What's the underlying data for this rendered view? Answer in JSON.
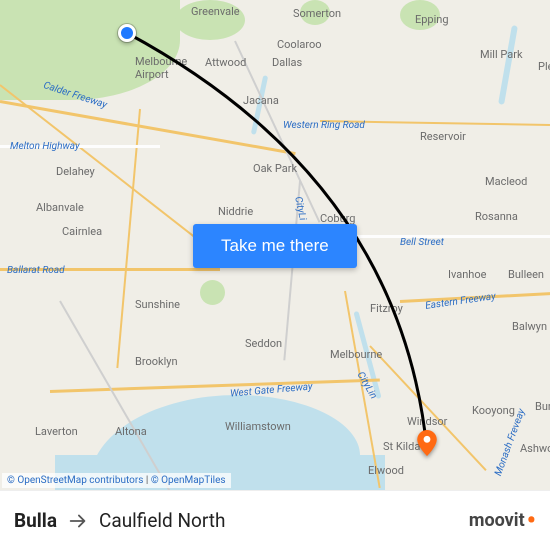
{
  "cta": {
    "label": "Take me there"
  },
  "route": {
    "from": "Bulla",
    "to": "Caulfield North"
  },
  "attribution": {
    "osm": "© OpenStreetMap contributors",
    "tiles": "© OpenMapTiles"
  },
  "brand": {
    "name": "moovit"
  },
  "map_labels": {
    "greenvale": "Greenvale",
    "somerton": "Somerton",
    "epping": "Epping",
    "melb_airport": "Melbourne\nAirport",
    "attwood": "Attwood",
    "dallas": "Dallas",
    "coolaroo": "Coolaroo",
    "mill_park": "Mill Park",
    "ple": "Ple",
    "jacana": "Jacana",
    "calder": "Calder Freeway",
    "western_ring": "Western Ring Road",
    "reservoir": "Reservoir",
    "melton_hwy": "Melton Highway",
    "delahey": "Delahey",
    "oak_park": "Oak Park",
    "macleod": "Macleod",
    "albanvale": "Albanvale",
    "niddrie": "Niddrie",
    "cityl1": "CityLi",
    "coburg": "Coburg",
    "rosanna": "Rosanna",
    "cairnlea": "Cairnlea",
    "bell": "Bell Street",
    "ballarat_rd": "Ballarat Road",
    "ivanhoe": "Ivanhoe",
    "bulleen": "Bulleen",
    "sunshine": "Sunshine",
    "fitzroy": "Fitzroy",
    "eastern_fwy": "Eastern Freeway",
    "balwyn": "Balwyn",
    "seddon": "Seddon",
    "brooklyn": "Brooklyn",
    "melbourne": "Melbourne",
    "westgate": "West Gate Freeway",
    "cityl2": "CityLin",
    "williamstown": "Williamstown",
    "windsor": "Windsor",
    "kooyong": "Kooyong",
    "bur": "Bur",
    "laverton": "Laverton",
    "altona": "Altona",
    "stkilda": "St Kilda E",
    "monash": "Monash Freveay",
    "ashwo": "Ashwo",
    "elwood": "Elwood"
  }
}
